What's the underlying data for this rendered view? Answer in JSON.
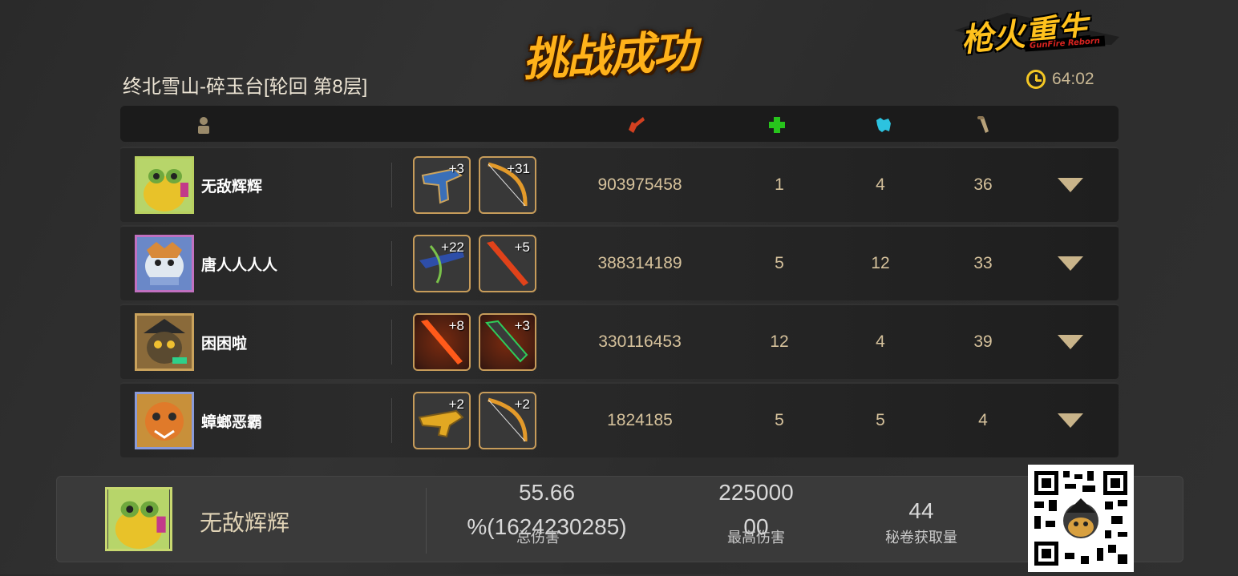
{
  "banner": "挑战成功",
  "logo": {
    "title": "枪火重生",
    "subtitle": "GunFire Reborn"
  },
  "stage_title": "终北雪山-碎玉台[轮回  第8层]",
  "timer": {
    "icon": "clock-icon",
    "value": "64:02"
  },
  "header_icons": {
    "player": "player-icon",
    "damage": "damage-icon",
    "heal": "heal-cross-icon",
    "pet": "pet-icon",
    "scroll": "scroll-icon"
  },
  "colors": {
    "accent_gold": "#c79c5a",
    "heal_green": "#27c41c",
    "pet_cyan": "#2cc3e0",
    "damage_red": "#d24020",
    "banner_orange": "#ffb21a"
  },
  "players": [
    {
      "name": "无敌辉辉",
      "weapons": [
        {
          "level": "+3",
          "icon": "blue-gun-icon"
        },
        {
          "level": "+31",
          "icon": "bow-icon"
        }
      ],
      "damage": "903975458",
      "heal": "1",
      "pet": "4",
      "scroll": "36"
    },
    {
      "name": "唐人人人人",
      "weapons": [
        {
          "level": "+22",
          "icon": "crossbow-icon"
        },
        {
          "level": "+5",
          "icon": "fire-spear-icon"
        }
      ],
      "damage": "388314189",
      "heal": "5",
      "pet": "12",
      "scroll": "33"
    },
    {
      "name": "困困啦",
      "weapons": [
        {
          "level": "+8",
          "icon": "fire-spear-icon"
        },
        {
          "level": "+3",
          "icon": "dagger-icon"
        }
      ],
      "damage": "330116453",
      "heal": "12",
      "pet": "4",
      "scroll": "39"
    },
    {
      "name": "蟑螂恶霸",
      "weapons": [
        {
          "level": "+2",
          "icon": "gold-gun-icon"
        },
        {
          "level": "+2",
          "icon": "bow-icon"
        }
      ],
      "damage": "1824185",
      "heal": "5",
      "pet": "5",
      "scroll": "4"
    }
  ],
  "summary": {
    "name": "无敌辉辉",
    "total_damage_line1": "55.66",
    "total_damage_line2": "%(1624230285)",
    "total_damage_label": "总伤害",
    "max_damage_line1": "225000",
    "max_damage_line2": "00",
    "max_damage_label": "最高伤害",
    "scrolls_value": "44",
    "scrolls_label": "秘卷获取量"
  },
  "qr": {
    "icon": "qr-code-icon"
  }
}
